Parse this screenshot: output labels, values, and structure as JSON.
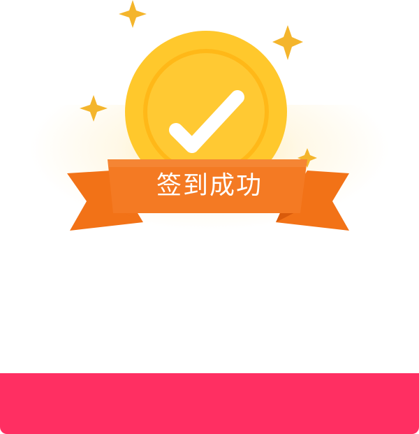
{
  "dialog": {
    "title": "签到成功",
    "icons": [
      "sparkle-star-icon",
      "gold-coin-icon",
      "checkmark-icon",
      "ribbon-banner"
    ],
    "colors": {
      "ribbon": "#f47a23",
      "coin": "#ffc82c",
      "sparkle": "#f4b52c",
      "footer": "#ff2f62"
    }
  },
  "footer": {
    "label": ""
  }
}
